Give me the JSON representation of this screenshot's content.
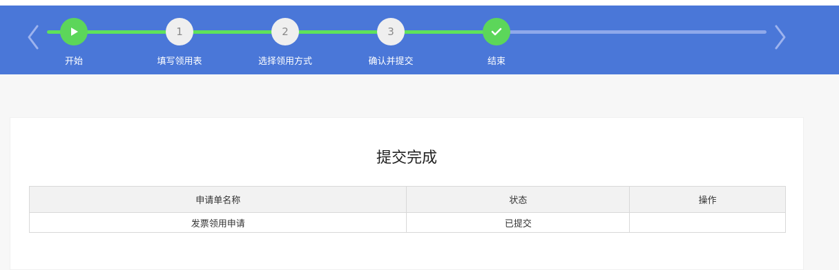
{
  "stepper": {
    "steps": [
      {
        "label": "开始",
        "state": "done",
        "icon": "play-icon"
      },
      {
        "label": "填写领用表",
        "state": "done",
        "number": "1"
      },
      {
        "label": "选择领用方式",
        "state": "done",
        "number": "2"
      },
      {
        "label": "确认并提交",
        "state": "done",
        "number": "3"
      },
      {
        "label": "结束",
        "state": "current",
        "icon": "check-icon"
      }
    ],
    "colors": {
      "bar_bg": "#4a77d8",
      "done": "#5cd65a",
      "pending_track": "#8fa8ea",
      "number_node": "#efefef"
    }
  },
  "main": {
    "title": "提交完成",
    "table": {
      "headers": [
        "申请单名称",
        "状态",
        "操作"
      ],
      "rows": [
        [
          "发票领用申请",
          "已提交",
          ""
        ]
      ]
    }
  }
}
